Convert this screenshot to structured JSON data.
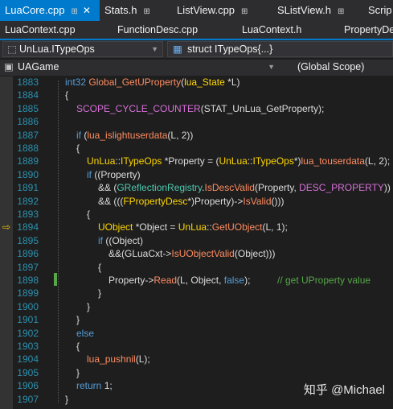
{
  "tabs": [
    {
      "label": "LuaCore.cpp",
      "pin": "⊞",
      "close": "✕",
      "active": true
    },
    {
      "label": "Stats.h",
      "pin": "⊞",
      "active": false
    },
    {
      "label": "ListView.cpp",
      "pin": "⊞",
      "active": false
    },
    {
      "label": "SListView.h",
      "pin": "⊞",
      "active": false
    },
    {
      "label": "Scrip",
      "active": false
    }
  ],
  "tabs2": [
    "LuaContext.cpp",
    "FunctionDesc.cpp",
    "LuaContext.h",
    "PropertyDe"
  ],
  "nav": {
    "scope_left": "UnLua.ITypeOps",
    "scope_right": "struct ITypeOps{...}",
    "project": "UAGame",
    "global": "(Global Scope)"
  },
  "lines": [
    {
      "n": "1883"
    },
    {
      "n": "1884"
    },
    {
      "n": "1885"
    },
    {
      "n": "1886"
    },
    {
      "n": "1887"
    },
    {
      "n": "1888"
    },
    {
      "n": "1889"
    },
    {
      "n": "1890"
    },
    {
      "n": "1891"
    },
    {
      "n": "1892"
    },
    {
      "n": "1893"
    },
    {
      "n": "1894"
    },
    {
      "n": "1895"
    },
    {
      "n": "1896"
    },
    {
      "n": "1897"
    },
    {
      "n": "1898"
    },
    {
      "n": "1899"
    },
    {
      "n": "1900"
    },
    {
      "n": "1901"
    },
    {
      "n": "1902"
    },
    {
      "n": "1903"
    },
    {
      "n": "1904"
    },
    {
      "n": "1905"
    },
    {
      "n": "1906"
    },
    {
      "n": "1907"
    }
  ],
  "code": {
    "l1883": [
      "int32 ",
      "Global_GetUProperty",
      "(",
      "lua_State",
      " *L)"
    ],
    "l1884": "{",
    "l1885": [
      "SCOPE_CYCLE_COUNTER",
      "(STAT_UnLua_GetProperty);"
    ],
    "l1887": [
      "if",
      " (",
      "lua_islightuserdata",
      "(L, 2))"
    ],
    "l1888": "{",
    "l1889": [
      "UnLua",
      "::",
      "ITypeOps",
      " *Property = (",
      "UnLua",
      "::",
      "ITypeOps",
      "*)",
      "lua_touserdata",
      "(L, 2);"
    ],
    "l1890": [
      "if",
      " ((Property)"
    ],
    "l1891": [
      "&& (",
      "GReflectionRegistry",
      ".",
      "IsDescValid",
      "(Property, ",
      "DESC_PROPERTY",
      "))"
    ],
    "l1892": [
      "&& (((",
      "FPropertyDesc",
      "*)Property)->",
      "IsValid",
      "()))"
    ],
    "l1893": "{",
    "l1894": [
      "UObject",
      " *Object = ",
      "UnLua",
      "::",
      "GetUObject",
      "(L, 1);"
    ],
    "l1895": [
      "if",
      " ((Object)"
    ],
    "l1896": [
      "&&(GLuaCxt->",
      "IsUObjectValid",
      "(Object)))"
    ],
    "l1897": "{",
    "l1898": [
      "Property->",
      "Read",
      "(L, Object, ",
      "false",
      ");",
      "// get UProperty value"
    ],
    "l1899": "}",
    "l1900": "}",
    "l1901": "}",
    "l1902": "else",
    "l1903": "{",
    "l1904": [
      "lua_pushnil",
      "(L);"
    ],
    "l1905": "}",
    "l1906": [
      "return",
      " 1;"
    ],
    "l1907": "}"
  },
  "marker": "⇨",
  "watermark": "知乎 @Michael",
  "colors": {
    "accent": "#007acc",
    "keyword": "#569cd6",
    "comment": "#57a64a",
    "linenumber": "#2b91af"
  }
}
